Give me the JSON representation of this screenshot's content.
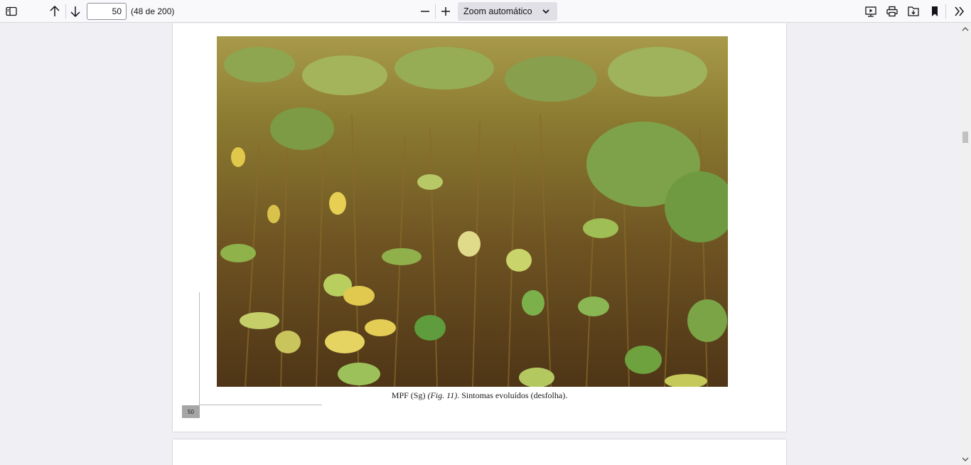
{
  "toolbar": {
    "page_number": "50",
    "page_count": "(48 de 200)",
    "zoom_label": "Zoom automático"
  },
  "document": {
    "caption_main": "MPF (Sg) ",
    "caption_fig": "(Fig. 11)",
    "caption_rest": ". Sintomas evoluídos (desfolha).",
    "page_footer_number": "50"
  },
  "colors": {
    "toolbar_bg": "#f9f9fb",
    "viewer_bg": "#f0f0f4",
    "zoom_bg": "#e0e0e6"
  },
  "icons": {
    "sidebar_toggle": "sidebar-toggle-icon",
    "prev_page": "arrow-up-icon",
    "next_page": "arrow-down-icon",
    "zoom_out": "minus-icon",
    "zoom_in": "plus-icon",
    "presentation": "presentation-icon",
    "print": "print-icon",
    "save": "save-icon",
    "bookmark": "bookmark-icon",
    "tools": "double-chevron-right-icon"
  }
}
